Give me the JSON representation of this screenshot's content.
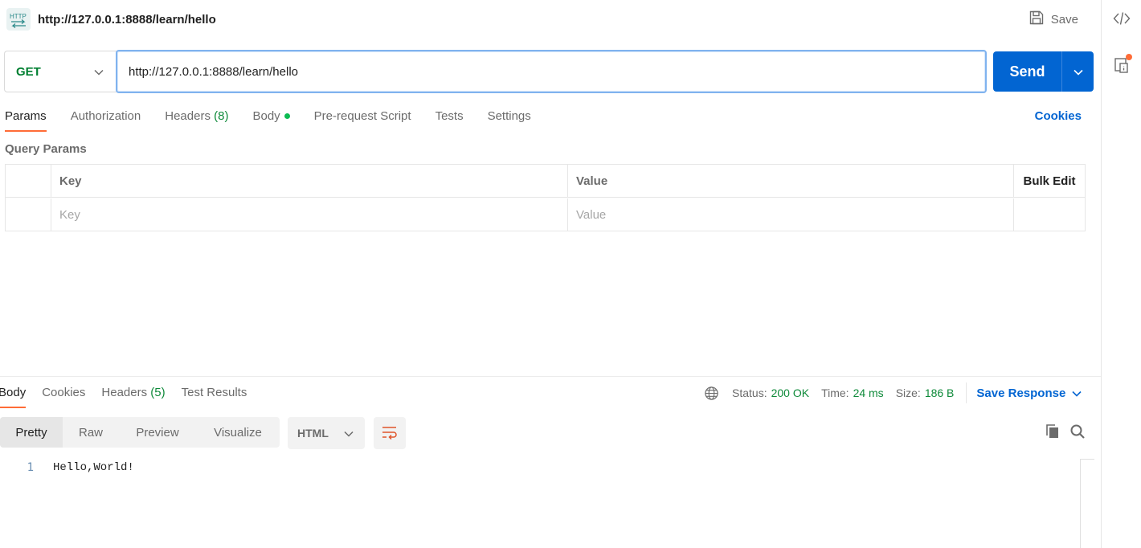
{
  "title_row": {
    "icon_label": "HTTP",
    "request_name": "http://127.0.0.1:8888/learn/hello",
    "save_label": "Save"
  },
  "url_bar": {
    "method": "GET",
    "url": "http://127.0.0.1:8888/learn/hello",
    "send_label": "Send"
  },
  "request_tabs": {
    "params": "Params",
    "authorization": "Authorization",
    "headers": "Headers",
    "headers_count": "(8)",
    "body": "Body",
    "pre_request": "Pre-request Script",
    "tests": "Tests",
    "settings": "Settings",
    "cookies": "Cookies"
  },
  "query_params": {
    "label": "Query Params",
    "columns": {
      "key": "Key",
      "value": "Value",
      "bulk_edit": "Bulk Edit"
    },
    "placeholder_row": {
      "key": "Key",
      "value": "Value"
    }
  },
  "response": {
    "tabs": {
      "body": "Body",
      "cookies": "Cookies",
      "headers": "Headers",
      "headers_count": "(5)",
      "test_results": "Test Results"
    },
    "meta": {
      "status_label": "Status:",
      "status_value": "200 OK",
      "time_label": "Time:",
      "time_value": "24 ms",
      "size_label": "Size:",
      "size_value": "186 B"
    },
    "save_response": "Save Response",
    "views": [
      "Pretty",
      "Raw",
      "Preview",
      "Visualize"
    ],
    "format": "HTML",
    "lines": [
      {
        "no": "1",
        "text": "Hello,World!"
      }
    ]
  },
  "colors": {
    "accent": "#ff6c37",
    "primary": "#0265d2",
    "method_get": "#007f31",
    "success": "#0f8a3a"
  }
}
